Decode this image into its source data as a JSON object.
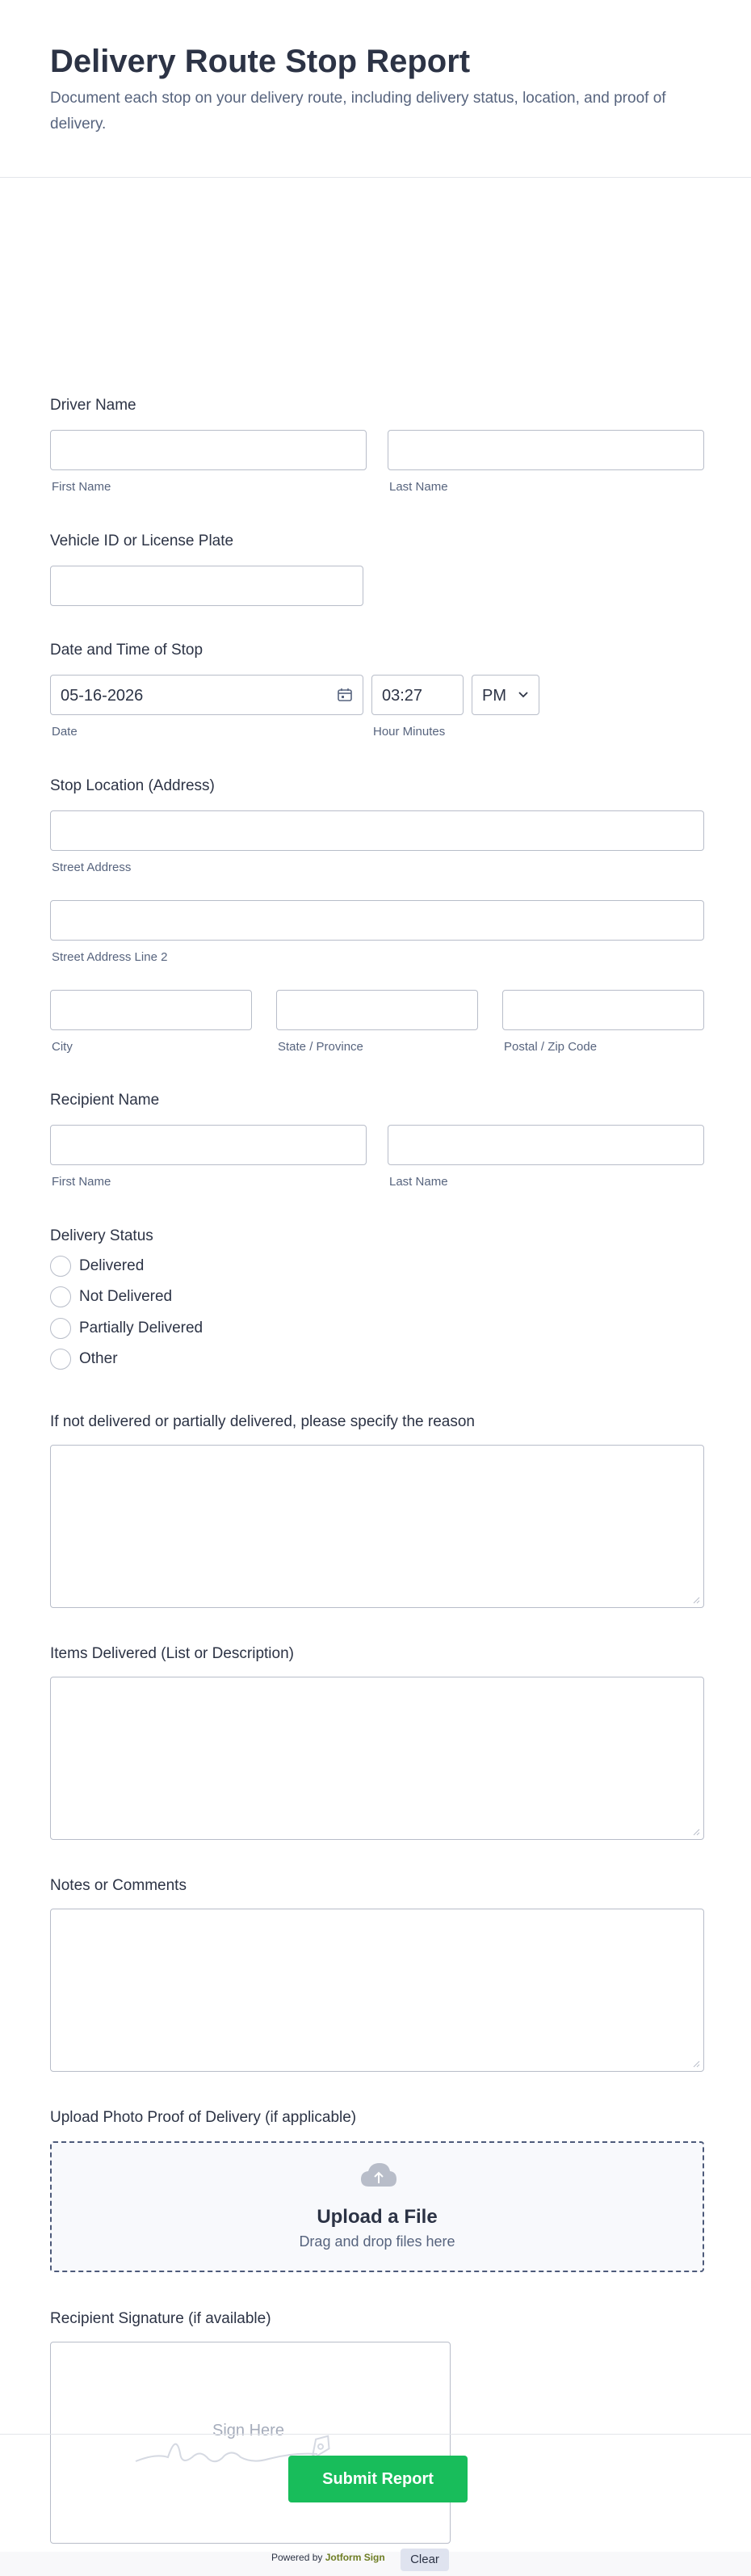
{
  "form": {
    "title": "Delivery Route Stop Report",
    "description": "Document each stop on your delivery route, including delivery status, location, and proof of delivery."
  },
  "driver_name": {
    "label": "Driver Name",
    "first_sublabel": "First Name",
    "last_sublabel": "Last Name"
  },
  "vehicle": {
    "label": "Vehicle ID or License Plate"
  },
  "datetime": {
    "label": "Date and Time of Stop",
    "date_value": "05-16-2026",
    "time_value": "03:27",
    "ampm_value": "PM",
    "date_sublabel": "Date",
    "time_sublabel": "Hour Minutes"
  },
  "location": {
    "label": "Stop Location (Address)",
    "street_sublabel": "Street Address",
    "street2_sublabel": "Street Address Line 2",
    "city_sublabel": "City",
    "state_sublabel": "State / Province",
    "zip_sublabel": "Postal / Zip Code"
  },
  "recipient_name": {
    "label": "Recipient Name",
    "first_sublabel": "First Name",
    "last_sublabel": "Last Name"
  },
  "delivery_status": {
    "label": "Delivery Status",
    "options": [
      "Delivered",
      "Not Delivered",
      "Partially Delivered",
      "Other"
    ]
  },
  "reason": {
    "label": "If not delivered or partially delivered, please specify the reason"
  },
  "items": {
    "label": "Items Delivered (List or Description)"
  },
  "notes": {
    "label": "Notes or Comments"
  },
  "upload": {
    "label": "Upload Photo Proof of Delivery (if applicable)",
    "title": "Upload a File",
    "hint": "Drag and drop files here"
  },
  "signature": {
    "label": "Recipient Signature (if available)",
    "placeholder": "Sign Here",
    "powered_prefix": "Powered by",
    "powered_brand": "Jotform Sign",
    "clear_label": "Clear"
  },
  "submit": {
    "label": "Submit Report"
  },
  "colors": {
    "accent_green": "#18bd5b",
    "text_primary": "#2c3345",
    "text_secondary": "#57647e",
    "border": "#b8bdc9"
  }
}
